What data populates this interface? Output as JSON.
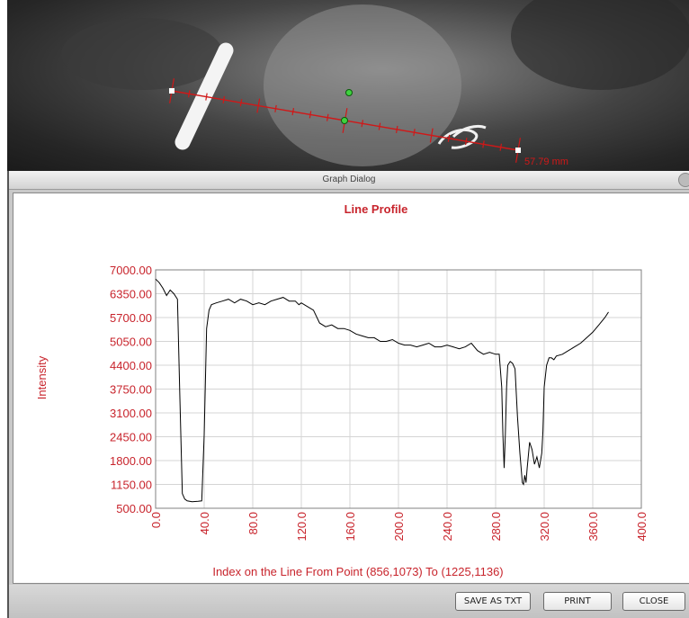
{
  "xray_overlay": {
    "measurement_label": "57.79 mm"
  },
  "dialog": {
    "title": "Graph Dialog"
  },
  "buttons": {
    "save_label": "SAVE AS TXT",
    "print_label": "PRINT",
    "close_label": "CLOSE"
  },
  "colors": {
    "axis_text": "#c8242c",
    "title_text": "#c8242c",
    "profile_line": "#000000",
    "measurement_line": "#d01818"
  },
  "chart_data": {
    "type": "line",
    "title": "Line Profile",
    "xlabel": "Index on the Line From Point (856,1073) To (1225,1136)",
    "ylabel": "Intensity",
    "xlim": [
      0,
      400
    ],
    "ylim": [
      500,
      7000
    ],
    "x_ticks": [
      "0.0",
      "40.0",
      "80.0",
      "120.0",
      "160.0",
      "200.0",
      "240.0",
      "280.0",
      "320.0",
      "360.0",
      "400.0"
    ],
    "y_ticks": [
      "500.00",
      "1150.00",
      "1800.00",
      "2450.00",
      "3100.00",
      "3750.00",
      "4400.00",
      "5050.00",
      "5700.00",
      "6350.00",
      "7000.00"
    ],
    "grid": true,
    "series": [
      {
        "x": [
          0,
          3,
          6,
          9,
          12,
          15,
          18,
          20,
          22,
          24,
          26,
          30,
          35,
          38,
          40,
          42,
          44,
          46,
          50,
          55,
          60,
          65,
          70,
          75,
          80,
          85,
          90,
          95,
          100,
          105,
          110,
          115,
          118,
          120,
          125,
          130,
          135,
          140,
          145,
          150,
          155,
          160,
          165,
          170,
          175,
          180,
          185,
          190,
          195,
          200,
          205,
          210,
          215,
          220,
          225,
          230,
          235,
          240,
          245,
          250,
          255,
          260,
          265,
          270,
          275,
          280,
          283,
          285,
          286,
          287,
          288,
          289,
          290,
          292,
          294,
          296,
          298,
          300,
          302,
          303,
          304,
          305,
          306,
          308,
          310,
          312,
          314,
          316,
          318,
          319,
          320,
          322,
          324,
          326,
          328,
          330,
          335,
          340,
          345,
          350,
          355,
          360,
          365,
          370,
          373
        ],
        "y": [
          6750,
          6650,
          6500,
          6300,
          6450,
          6350,
          6200,
          3500,
          900,
          750,
          700,
          680,
          690,
          700,
          2500,
          5400,
          5900,
          6050,
          6100,
          6150,
          6200,
          6100,
          6200,
          6150,
          6050,
          6100,
          6050,
          6150,
          6200,
          6250,
          6150,
          6150,
          6050,
          6100,
          6000,
          5900,
          5550,
          5450,
          5500,
          5400,
          5400,
          5350,
          5250,
          5200,
          5150,
          5150,
          5050,
          5050,
          5100,
          5000,
          4950,
          4950,
          4900,
          4950,
          5000,
          4900,
          4900,
          4950,
          4900,
          4850,
          4900,
          5000,
          4800,
          4700,
          4750,
          4700,
          4700,
          3800,
          2500,
          1600,
          2500,
          3800,
          4400,
          4500,
          4450,
          4300,
          3000,
          2000,
          1200,
          1150,
          1400,
          1200,
          1600,
          2300,
          2100,
          1700,
          1900,
          1600,
          2000,
          2600,
          3800,
          4400,
          4600,
          4600,
          4550,
          4650,
          4700,
          4800,
          4900,
          5000,
          5150,
          5300,
          5500,
          5700,
          5850
        ]
      }
    ]
  }
}
